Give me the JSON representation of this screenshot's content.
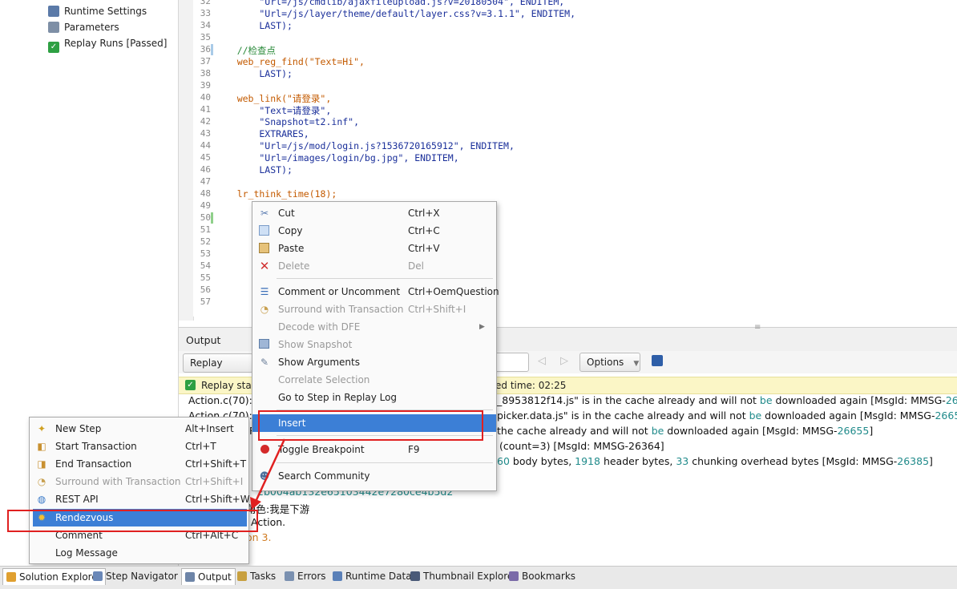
{
  "solution_tree": {
    "items": [
      {
        "label": "Runtime Settings",
        "icon": "settings-icon"
      },
      {
        "label": "Parameters",
        "icon": "parameters-icon"
      },
      {
        "label": "Replay Runs [Passed]",
        "icon": "check-icon"
      }
    ]
  },
  "editor": {
    "lines": [
      {
        "n": "32",
        "text": "        \"Url=/js/cmdlib/ajaxfileupload.js?v=20180504\", ENDITEM,"
      },
      {
        "n": "33",
        "text": "        \"Url=/js/layer/theme/default/layer.css?v=3.1.1\", ENDITEM,"
      },
      {
        "n": "34",
        "text": "        LAST);"
      },
      {
        "n": "35",
        "text": ""
      },
      {
        "n": "36",
        "text": "    //检查点"
      },
      {
        "n": "37",
        "text": "    web_reg_find(\"Text=Hi\","
      },
      {
        "n": "38",
        "text": "        LAST);"
      },
      {
        "n": "39",
        "text": ""
      },
      {
        "n": "40",
        "text": "    web_link(\"请登录\","
      },
      {
        "n": "41",
        "text": "        \"Text=请登录\","
      },
      {
        "n": "42",
        "text": "        \"Snapshot=t2.inf\","
      },
      {
        "n": "43",
        "text": "        EXTRARES,"
      },
      {
        "n": "44",
        "text": "        \"Url=/js/mod/login.js?1536720165912\", ENDITEM,"
      },
      {
        "n": "45",
        "text": "        \"Url=/images/login/bg.jpg\", ENDITEM,"
      },
      {
        "n": "46",
        "text": "        LAST);"
      },
      {
        "n": "47",
        "text": ""
      },
      {
        "n": "48",
        "text": "    lr_think_time(18);"
      },
      {
        "n": "49",
        "text": ""
      },
      {
        "n": "50",
        "text": "    "
      },
      {
        "n": "51",
        "text": ""
      },
      {
        "n": "52",
        "text": ""
      },
      {
        "n": "53",
        "text": "    "
      },
      {
        "n": "54",
        "text": "                                         login\","
      },
      {
        "n": "55",
        "text": ""
      },
      {
        "n": "56",
        "text": ""
      },
      {
        "n": "57",
        "text": "                                         in\","
      }
    ]
  },
  "output": {
    "title": "Output",
    "filter_value": "Replay",
    "options_label": "Options",
    "status_left": "Replay status",
    "status_right": "ed time: 02:25",
    "log_lines": [
      {
        "prefix": "Action.c(70): R",
        "mid": "_8953812f14.js\" is in the cache already and will not ",
        "be": "be",
        "tail": " downloaded again    [MsgId: MMSG-",
        "code": "26655",
        "end": "]"
      },
      {
        "prefix": "Action.c(70): R",
        "mid": "picker.data.js\" is in the cache already and will not ",
        "be": "be",
        "tail": " downloaded again       [MsgId: MMSG-",
        "code": "26655",
        "end": "]"
      },
      {
        "prefix": "R",
        "mid": "the cache already and will not ",
        "be": "be",
        "tail": " downloaded again       [MsgId: MMSG-",
        "code": "26655",
        "end": "]"
      }
    ],
    "log_count": "(count=3)    [MsgId: MMSG-26364]",
    "log_bytes_a": "60",
    "log_bytes_b": " body bytes, ",
    "log_bytes_c": "1918",
    "log_bytes_d": " header bytes, ",
    "log_bytes_e": "33",
    "log_bytes_f": " chunking overhead bytes    [MsgId: MMSG-",
    "log_bytes_code": "26385",
    "log_bytes_end": "]",
    "log_hash": "2b004ab132e65103442e7280ce4b5d2",
    "log_role": "角色:我是下游",
    "log_action": "Action.",
    "log_iter": "on 3."
  },
  "context_menu": {
    "items": [
      {
        "label": "Cut",
        "shortcut": "Ctrl+X",
        "icon": "scissors-icon",
        "disabled": false
      },
      {
        "label": "Copy",
        "shortcut": "Ctrl+C",
        "icon": "copy-icon",
        "disabled": false
      },
      {
        "label": "Paste",
        "shortcut": "Ctrl+V",
        "icon": "paste-icon",
        "disabled": false
      },
      {
        "label": "Delete",
        "shortcut": "Del",
        "icon": "delete-icon",
        "disabled": true
      },
      {
        "label": "Comment or Uncomment",
        "shortcut": "Ctrl+OemQuestion",
        "icon": "comment-icon",
        "disabled": false
      },
      {
        "label": "Surround with Transaction",
        "shortcut": "Ctrl+Shift+I",
        "icon": "transaction-icon",
        "disabled": true
      },
      {
        "label": "Decode with DFE",
        "shortcut": "",
        "icon": "",
        "disabled": true
      },
      {
        "label": "Show Snapshot",
        "shortcut": "",
        "icon": "snapshot-icon",
        "disabled": true
      },
      {
        "label": "Show Arguments",
        "shortcut": "",
        "icon": "arguments-icon",
        "disabled": false
      },
      {
        "label": "Correlate Selection",
        "shortcut": "",
        "icon": "",
        "disabled": true
      },
      {
        "label": "Go to Step in Replay Log",
        "shortcut": "",
        "icon": "",
        "disabled": false
      },
      {
        "label": "Insert",
        "shortcut": "",
        "icon": "",
        "disabled": false
      },
      {
        "label": "Toggle Breakpoint",
        "shortcut": "F9",
        "icon": "breakpoint-icon",
        "disabled": false
      },
      {
        "label": "Search Community",
        "shortcut": "",
        "icon": "community-icon",
        "disabled": false
      }
    ]
  },
  "insert_submenu": {
    "items": [
      {
        "label": "New Step",
        "shortcut": "Alt+Insert",
        "icon": "new-step-icon",
        "disabled": false
      },
      {
        "label": "Start Transaction",
        "shortcut": "Ctrl+T",
        "icon": "start-transaction-icon",
        "disabled": false
      },
      {
        "label": "End Transaction",
        "shortcut": "Ctrl+Shift+T",
        "icon": "end-transaction-icon",
        "disabled": false
      },
      {
        "label": "Surround with Transaction",
        "shortcut": "Ctrl+Shift+I",
        "icon": "transaction-icon",
        "disabled": true
      },
      {
        "label": "REST API",
        "shortcut": "Ctrl+Shift+W",
        "icon": "globe-icon",
        "disabled": false
      },
      {
        "label": "Rendezvous",
        "shortcut": "",
        "icon": "rendezvous-icon",
        "disabled": false
      },
      {
        "label": "Comment",
        "shortcut": "Ctrl+Alt+C",
        "icon": "",
        "disabled": false
      },
      {
        "label": "Log Message",
        "shortcut": "",
        "icon": "",
        "disabled": false
      }
    ]
  },
  "bottom_tabs": [
    {
      "label": "Solution Explorer",
      "icon": "solution-icon"
    },
    {
      "label": "Step Navigator",
      "icon": "navigator-icon"
    },
    {
      "label": "Output",
      "icon": "output-icon"
    },
    {
      "label": "Tasks",
      "icon": "tasks-icon"
    },
    {
      "label": "Errors",
      "icon": "errors-icon"
    },
    {
      "label": "Runtime Data",
      "icon": "runtime-data-icon"
    },
    {
      "label": "Thumbnail Explorer",
      "icon": "thumbnail-icon"
    },
    {
      "label": "Bookmarks",
      "icon": "bookmarks-icon"
    }
  ],
  "colors": {
    "highlight": "#3c7fd6",
    "annotation": "#e02020",
    "status_bar": "#fbf6c6"
  }
}
